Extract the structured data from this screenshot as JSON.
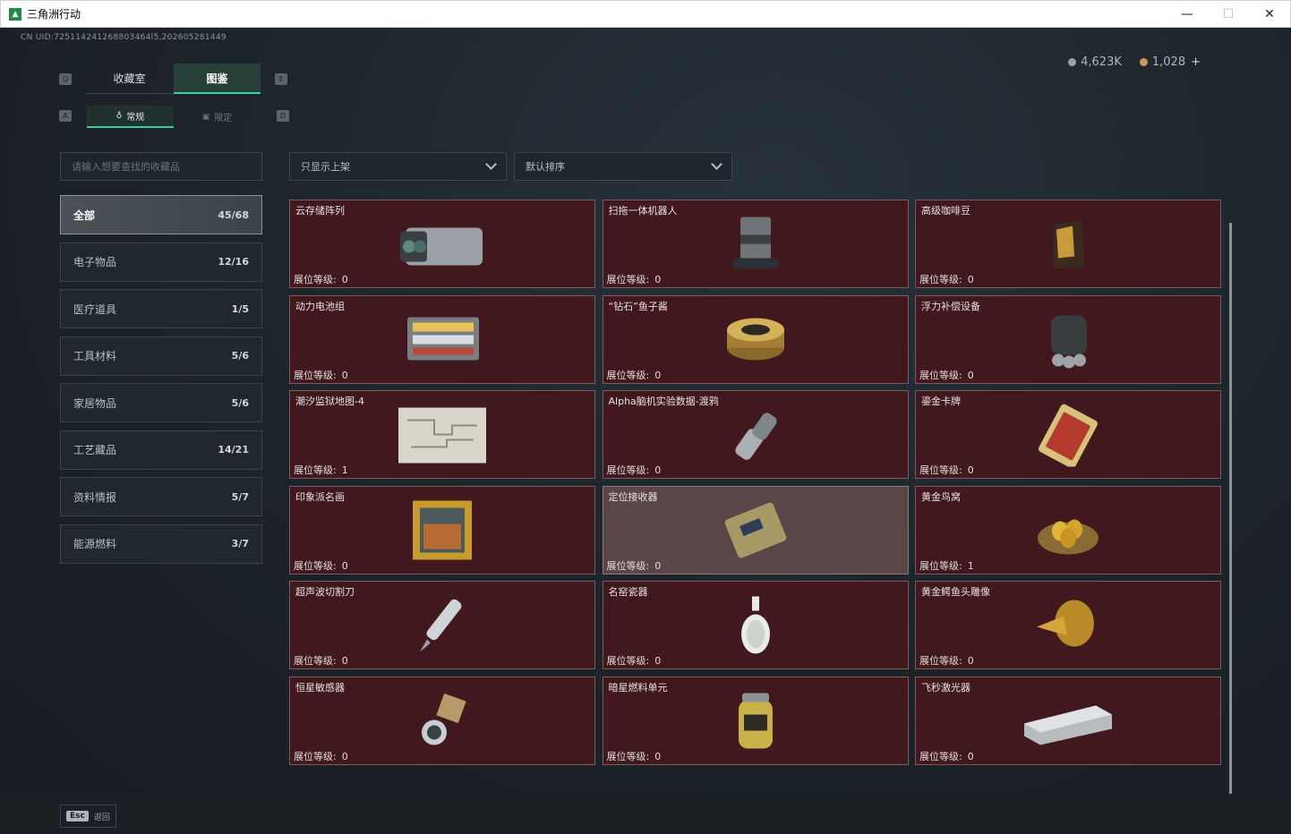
{
  "window": {
    "title": "三角洲行动",
    "minimize": "—",
    "maximize": "☐",
    "close": "✕"
  },
  "header": {
    "uid": "CN UID:725114241268803464l5,202605281449",
    "silver": "4,623K",
    "gold": "1,028",
    "plus": "+"
  },
  "keys": {
    "q": "Q",
    "e": "E",
    "a": "A",
    "d": "D"
  },
  "tabs": {
    "main": [
      {
        "label": "收藏室"
      },
      {
        "label": "图鉴"
      }
    ],
    "sub": [
      {
        "label": "常规"
      },
      {
        "label": "限定"
      }
    ]
  },
  "search": {
    "placeholder": "请输入想要查找的收藏品"
  },
  "categories": [
    {
      "label": "全部",
      "count": "45/68"
    },
    {
      "label": "电子物品",
      "count": "12/16"
    },
    {
      "label": "医疗道具",
      "count": "1/5"
    },
    {
      "label": "工具材料",
      "count": "5/6"
    },
    {
      "label": "家居物品",
      "count": "5/6"
    },
    {
      "label": "工艺藏品",
      "count": "14/21"
    },
    {
      "label": "资料情报",
      "count": "5/7"
    },
    {
      "label": "能源燃料",
      "count": "3/7"
    }
  ],
  "filters": {
    "display": "只显示上架",
    "sort": "默认排序"
  },
  "level_label": "展位等级:",
  "items": [
    {
      "name": "云存储阵列",
      "level": "0",
      "icon": "server-array-icon"
    },
    {
      "name": "扫拖一体机器人",
      "level": "0",
      "icon": "robot-vacuum-icon"
    },
    {
      "name": "高级咖啡豆",
      "level": "0",
      "icon": "coffee-bag-icon"
    },
    {
      "name": "动力电池组",
      "level": "0",
      "icon": "battery-pack-icon"
    },
    {
      "name": "“钻石”鱼子酱",
      "level": "0",
      "icon": "caviar-tin-icon"
    },
    {
      "name": "浮力补偿设备",
      "level": "0",
      "icon": "buoyancy-device-icon"
    },
    {
      "name": "潮汐监狱地图-4",
      "level": "1",
      "icon": "map-icon"
    },
    {
      "name": "Alpha脑机实验数据-渡鸦",
      "level": "0",
      "icon": "data-drive-icon"
    },
    {
      "name": "鎏金卡牌",
      "level": "0",
      "icon": "gold-card-icon"
    },
    {
      "name": "印象派名画",
      "level": "0",
      "icon": "painting-icon"
    },
    {
      "name": "定位接收器",
      "level": "0",
      "icon": "gps-receiver-icon"
    },
    {
      "name": "黄金鸟窝",
      "level": "1",
      "icon": "golden-nest-icon"
    },
    {
      "name": "超声波切割刀",
      "level": "0",
      "icon": "ultrasonic-cutter-icon"
    },
    {
      "name": "名窑瓷器",
      "level": "0",
      "icon": "porcelain-vase-icon"
    },
    {
      "name": "黄金鳄鱼头雕像",
      "level": "0",
      "icon": "gold-crocodile-icon"
    },
    {
      "name": "恒星敏感器",
      "level": "0",
      "icon": "star-sensor-icon"
    },
    {
      "name": "暗星燃料单元",
      "level": "0",
      "icon": "fuel-cell-icon"
    },
    {
      "name": "飞秒激光器",
      "level": "0",
      "icon": "laser-device-icon"
    }
  ],
  "footer": {
    "esc_key": "Esc",
    "back_label": "返回"
  }
}
